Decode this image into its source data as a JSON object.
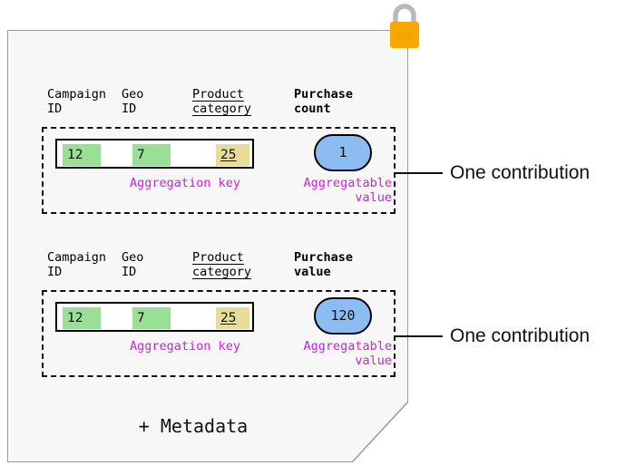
{
  "document": {
    "background_color": "#f7f7f7",
    "border_color": "#9a9a9a",
    "metadata_label": "+ Metadata"
  },
  "lock": {
    "icon": "padlock-icon",
    "body_color": "#f8a800",
    "shackle_color": "#b8b8b8"
  },
  "colors": {
    "key_cell_green": "#9adf96",
    "key_cell_yellow": "#e8dc9a",
    "value_pill_blue": "#8cbdf2",
    "annotation_purple": "#cc22dd",
    "outline_black": "#111111"
  },
  "contributions": [
    {
      "headers": {
        "campaign": "Campaign\nID",
        "geo": "Geo\nID",
        "product": "Product\ncategory",
        "value": "Purchase\ncount"
      },
      "aggregation_key": {
        "campaign_id": "12",
        "geo_id": "7",
        "product_category": "25"
      },
      "aggregatable_value": "1",
      "annotations": {
        "key": "Aggregation key",
        "value": "Aggregatable\nvalue"
      },
      "callout": "One contribution"
    },
    {
      "headers": {
        "campaign": "Campaign\nID",
        "geo": "Geo\nID",
        "product": "Product\ncategory",
        "value": "Purchase\nvalue"
      },
      "aggregation_key": {
        "campaign_id": "12",
        "geo_id": "7",
        "product_category": "25"
      },
      "aggregatable_value": "120",
      "annotations": {
        "key": "Aggregation key",
        "value": "Aggregatable\nvalue"
      },
      "callout": "One contribution"
    }
  ]
}
